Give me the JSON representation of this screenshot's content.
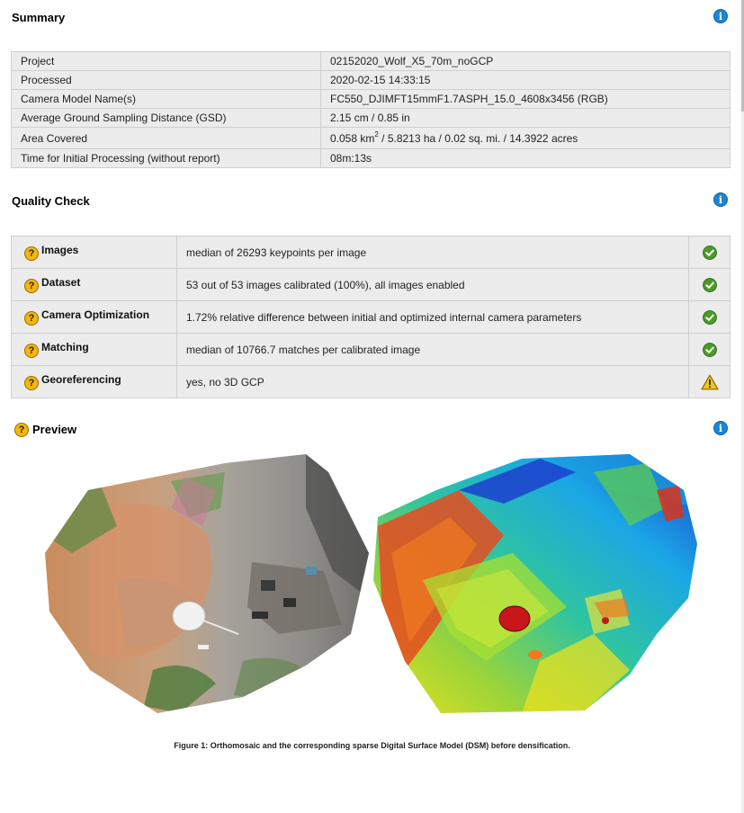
{
  "summary": {
    "title": "Summary",
    "rows": [
      {
        "key": "Project",
        "value": "02152020_Wolf_X5_70m_noGCP"
      },
      {
        "key": "Processed",
        "value": "2020-02-15 14:33:15"
      },
      {
        "key": "Camera Model Name(s)",
        "value": "FC550_DJIMFT15mmF1.7ASPH_15.0_4608x3456 (RGB)"
      },
      {
        "key": "Average Ground Sampling Distance (GSD)",
        "value": "2.15 cm / 0.85 in"
      },
      {
        "key": "Area Covered",
        "value_pre": "0.058 km",
        "value_sup": "2",
        "value_post": " / 5.8213 ha / 0.02 sq. mi. / 14.3922 acres"
      },
      {
        "key": "Time for Initial Processing (without report)",
        "value": "08m:13s"
      }
    ]
  },
  "quality": {
    "title": "Quality Check",
    "rows": [
      {
        "key": "Images",
        "value": "median of 26293 keypoints per image",
        "status": "ok"
      },
      {
        "key": "Dataset",
        "value": "53 out of 53 images calibrated (100%), all images enabled",
        "status": "ok"
      },
      {
        "key": "Camera Optimization",
        "value": "1.72% relative difference between initial and optimized internal camera parameters",
        "status": "ok"
      },
      {
        "key": "Matching",
        "value": "median of 10766.7 matches per calibrated image",
        "status": "ok"
      },
      {
        "key": "Georeferencing",
        "value": "yes, no 3D GCP",
        "status": "warning"
      }
    ]
  },
  "preview": {
    "title": "Preview",
    "caption": "Figure 1: Orthomosaic and the corresponding sparse Digital Surface Model (DSM) before densification."
  },
  "icons": {
    "info": "info-icon",
    "help": "question-icon",
    "ok": "check-circle-icon",
    "warning": "warning-triangle-icon"
  },
  "colors": {
    "info_blue": "#1a86d6",
    "ok_green": "#4c9a2a",
    "warning_yellow": "#f5c518",
    "help_orange": "#f5b50f",
    "row_bg": "#ececec"
  }
}
